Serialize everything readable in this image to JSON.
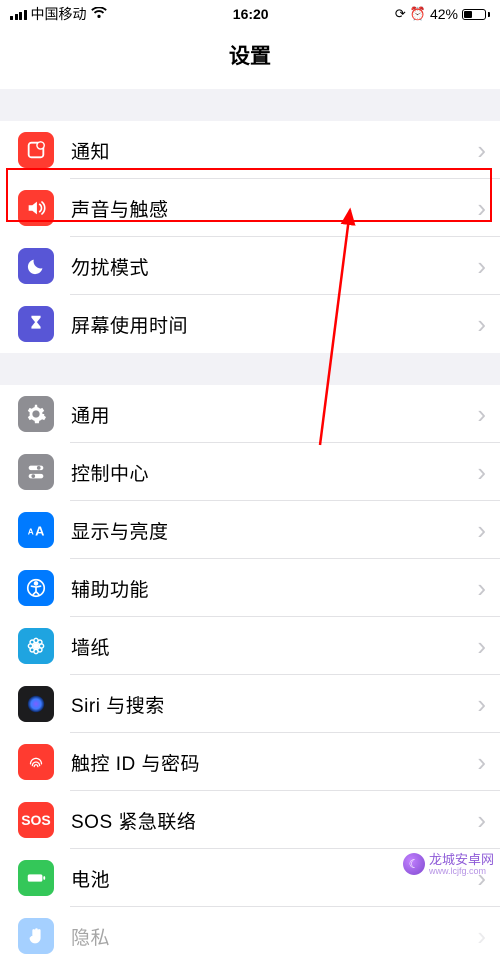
{
  "status": {
    "carrier": "中国移动",
    "time": "16:20",
    "battery_pct": "42%"
  },
  "header": {
    "title": "设置"
  },
  "group1": {
    "notifications": "通知",
    "sounds": "声音与触感",
    "dnd": "勿扰模式",
    "screentime": "屏幕使用时间"
  },
  "group2": {
    "general": "通用",
    "control_center": "控制中心",
    "display": "显示与亮度",
    "accessibility": "辅助功能",
    "wallpaper": "墙纸",
    "siri": "Siri 与搜索",
    "touchid": "触控 ID 与密码",
    "sos": "SOS 紧急联络",
    "battery": "电池",
    "privacy": "隐私"
  },
  "sos_text": "SOS",
  "watermark": {
    "name": "龙城安卓网",
    "url": "www.lcjfg.com"
  },
  "colors": {
    "red": "#ff3b30",
    "purple": "#5856d6",
    "indigo": "#5b5bd6",
    "grey": "#8e8e93",
    "blue": "#007aff",
    "cyan": "#1fa4e0",
    "green": "#34c759",
    "siri_bg": "#1c1c1e"
  }
}
